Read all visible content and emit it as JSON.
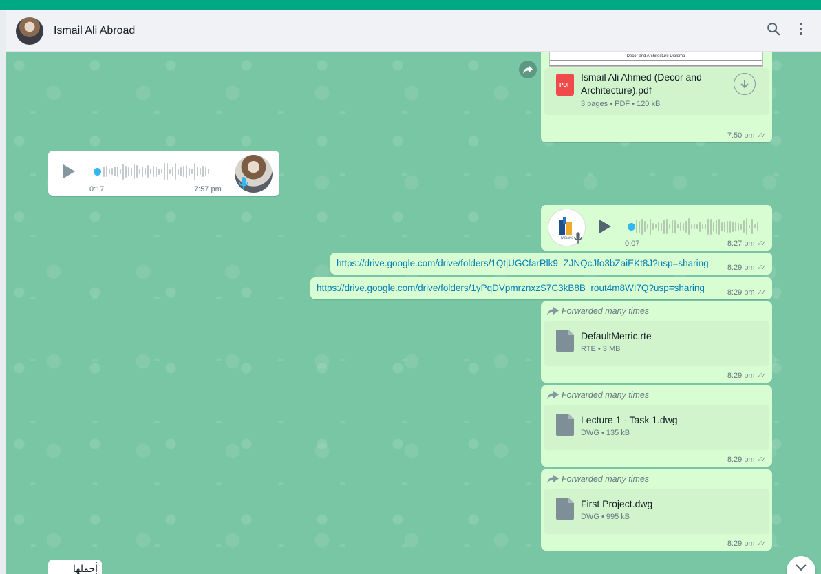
{
  "header": {
    "contact_name": "Ismail Ali Abroad",
    "avatar_icon": "contact-avatar",
    "search_icon": "search-icon",
    "menu_icon": "menu-icon"
  },
  "colors": {
    "accent": "#00a884",
    "outgoing_bubble": "#d9fdd3",
    "incoming_bubble": "#ffffff",
    "chat_background": "#79c6a4",
    "link": "#027eb5"
  },
  "messages": [
    {
      "type": "document",
      "direction": "outgoing",
      "preview_title": "Decor and Architecture Diploma",
      "file_name_line1": "Ismail Ali Ahmed (Decor and",
      "file_name_line2": "Architecture).pdf",
      "file_icon": "PDF",
      "meta": "3 pages • PDF • 120 kB",
      "time": "7:50 pm"
    },
    {
      "type": "voice",
      "direction": "incoming",
      "duration": "0:17",
      "time": "7:57 pm"
    },
    {
      "type": "voice",
      "direction": "outgoing",
      "duration": "0:07",
      "time": "8:27 pm"
    },
    {
      "type": "link",
      "direction": "outgoing",
      "text": "https://drive.google.com/drive/folders/1QtjUGCfarRlk9_ZJNQcJfo3bZaiEKt8J?usp=sharing",
      "time": "8:29 pm"
    },
    {
      "type": "link",
      "direction": "outgoing",
      "text": "https://drive.google.com/drive/folders/1yPqDVpmrznxzS7C3kB8B_rout4m8WI7Q?usp=sharing",
      "time": "8:29 pm"
    },
    {
      "type": "document",
      "direction": "outgoing",
      "forwarded": "Forwarded many times",
      "file_name": "DefaultMetric.rte",
      "meta": "RTE • 3 MB",
      "time": "8:29 pm"
    },
    {
      "type": "document",
      "direction": "outgoing",
      "forwarded": "Forwarded many times",
      "file_name": "Lecture 1 - Task 1.dwg",
      "meta": "DWG • 135 kB",
      "time": "8:29 pm"
    },
    {
      "type": "document",
      "direction": "outgoing",
      "forwarded": "Forwarded many times",
      "file_name": "First Project.dwg",
      "meta": "DWG • 995 kB",
      "time": "8:29 pm"
    },
    {
      "type": "text",
      "direction": "incoming",
      "text": "أجملها أزاي"
    }
  ]
}
